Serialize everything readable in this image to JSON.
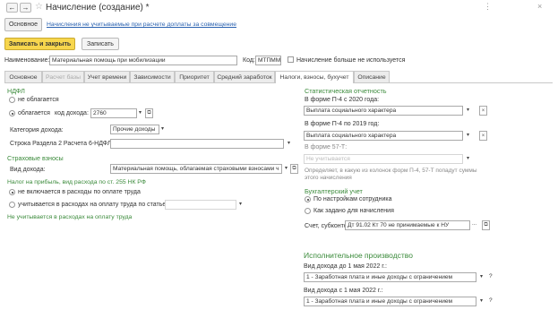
{
  "window": {
    "title": "Начисление (создание) *",
    "back_icon": "arrow-left-icon",
    "forward_icon": "arrow-right-icon",
    "star_icon": "star-icon"
  },
  "top_tabs": {
    "main": "Основное",
    "link": "Начисления не учитываемые при расчете доплаты за совмещение"
  },
  "toolbar": {
    "save_close": "Записать и закрыть",
    "save": "Записать"
  },
  "form": {
    "name_label": "Наименование:",
    "name_value": "Материальная помощь при мобилизации",
    "code_label": "Код:",
    "code_value": "МТПММ",
    "unused_label": "Начисление больше не используется"
  },
  "tabs": [
    "Основное",
    "Расчет базы",
    "Учет времени",
    "Зависимости",
    "Приоритет",
    "Средний заработок",
    "Налоги, взносы, бухучет",
    "Описание"
  ],
  "ndfl": {
    "header": "НДФЛ",
    "not_taxed": "не облагается",
    "taxed": "облагается",
    "code_label": "код дохода:",
    "code_value": "2760",
    "category_label": "Категория дохода:",
    "category_value": "Прочие доходы (основна",
    "line_label": "Строка Раздела 2 Расчета 6-НДФЛ:",
    "line_value": ""
  },
  "insurance": {
    "header": "Страховые взносы",
    "kind_label": "Вид дохода:",
    "kind_value": "Материальная помощь, облагаемая страховыми взносами ч"
  },
  "profit_tax": {
    "header": "Налог на прибыль, вид расхода по ст. 255 НК РФ",
    "opt1": "не включается в расходы по оплате труда",
    "opt2": "учитывается в расходах на оплату труда по статье:",
    "note": "Не учитывается в расходах на оплату труда"
  },
  "stat": {
    "header": "Статистическая отчетность",
    "p4_2020_label": "В форме П-4 с 2020 года:",
    "p4_2020_value": "Выплата социального характера",
    "p4_2019_label": "В форме П-4 по 2019 год:",
    "p4_2019_value": "Выплата социального характера",
    "f57_label": "В форме 57-Т:",
    "f57_value": "Не учитывается",
    "f57_note_1": "Определяет, в какую из колонок форм П-4, 57-Т попадут суммы",
    "f57_note_2": "этого начисления"
  },
  "accounting": {
    "header": "Бухгалтерский учет",
    "opt1": "По настройкам сотрудника",
    "opt2": "Как задано для начисления",
    "account_label": "Счет, субконто:",
    "account_value": "Дт 91.02 Кт 70 не принимаемые к НУ"
  },
  "enforcement": {
    "header": "Исполнительное производство",
    "before_label": "Вид дохода до 1 мая 2022 г.:",
    "before_value": "1 - Заработная плата и иные доходы с ограничением взыскания",
    "after_label": "Вид дохода с 1 мая 2022 г.:",
    "after_value": "1 - Заработная плата и иные доходы с ограничением взыскания"
  },
  "symbols": {
    "dropdown": "▾",
    "ellipsis": "...",
    "clear": "×",
    "open": "⧉",
    "question": "?",
    "dots": "⋯"
  }
}
